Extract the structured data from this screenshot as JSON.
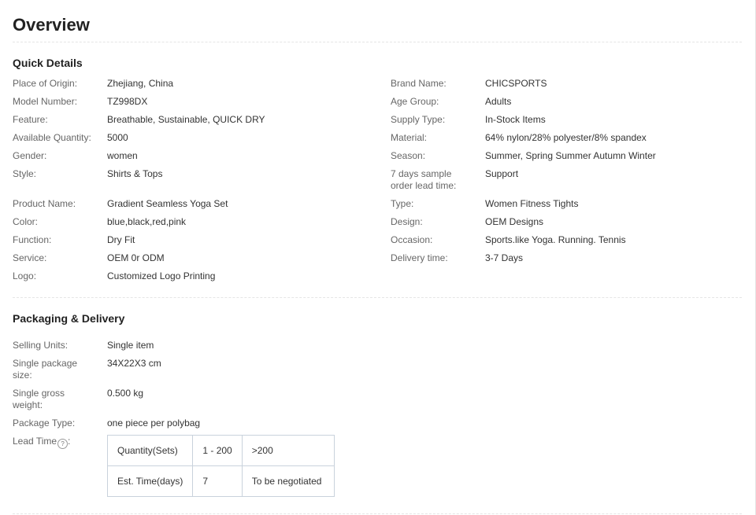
{
  "page": {
    "title": "Overview"
  },
  "quick_details": {
    "heading": "Quick Details",
    "left": [
      {
        "label": "Place of Origin:",
        "value": "Zhejiang, China"
      },
      {
        "label": "Model Number:",
        "value": "TZ998DX"
      },
      {
        "label": "Feature:",
        "value": "Breathable, Sustainable, QUICK DRY"
      },
      {
        "label": "Available Quantity:",
        "value": "5000"
      },
      {
        "label": "Gender:",
        "value": "women"
      },
      {
        "label": "Style:",
        "value": "Shirts & Tops"
      },
      {
        "label": "Product Name:",
        "value": "Gradient Seamless Yoga Set"
      },
      {
        "label": "Color:",
        "value": "blue,black,red,pink"
      },
      {
        "label": "Function:",
        "value": "Dry Fit"
      },
      {
        "label": "Service:",
        "value": "OEM 0r ODM"
      },
      {
        "label": "Logo:",
        "value": "Customized Logo Printing"
      }
    ],
    "right": [
      {
        "label": "Brand Name:",
        "value": "CHICSPORTS"
      },
      {
        "label": "Age Group:",
        "value": "Adults"
      },
      {
        "label": "Supply Type:",
        "value": "In-Stock Items"
      },
      {
        "label": "Material:",
        "value": "64% nylon/28% polyester/8% spandex"
      },
      {
        "label": "Season:",
        "value": "Summer, Spring Summer Autumn Winter"
      },
      {
        "label": "7 days sample order lead time:",
        "value": "Support"
      },
      {
        "label": "Type:",
        "value": "Women Fitness Tights"
      },
      {
        "label": "Design:",
        "value": "OEM Designs"
      },
      {
        "label": "Occasion:",
        "value": "Sports.like Yoga. Running. Tennis"
      },
      {
        "label": "Delivery time:",
        "value": "3-7 Days"
      }
    ]
  },
  "packaging": {
    "heading": "Packaging & Delivery",
    "rows": [
      {
        "label": "Selling Units:",
        "value": "Single item"
      },
      {
        "label": "Single package size:",
        "value": "34X22X3 cm"
      },
      {
        "label": "Single gross weight:",
        "value": "0.500 kg"
      },
      {
        "label": "Package Type:",
        "value": "one piece per polybag"
      }
    ],
    "lead_time_label": "Lead Time",
    "lead_time_suffix": ":",
    "help_icon": "?",
    "lead_table": {
      "row1": [
        "Quantity(Sets)",
        "1 - 200",
        ">200"
      ],
      "row2": [
        "Est. Time(days)",
        "7",
        "To be negotiated"
      ]
    }
  },
  "colors": {
    "label": "#666666",
    "value": "#333333",
    "table_border": "#c9d2dc",
    "divider": "#e5e5e5"
  }
}
